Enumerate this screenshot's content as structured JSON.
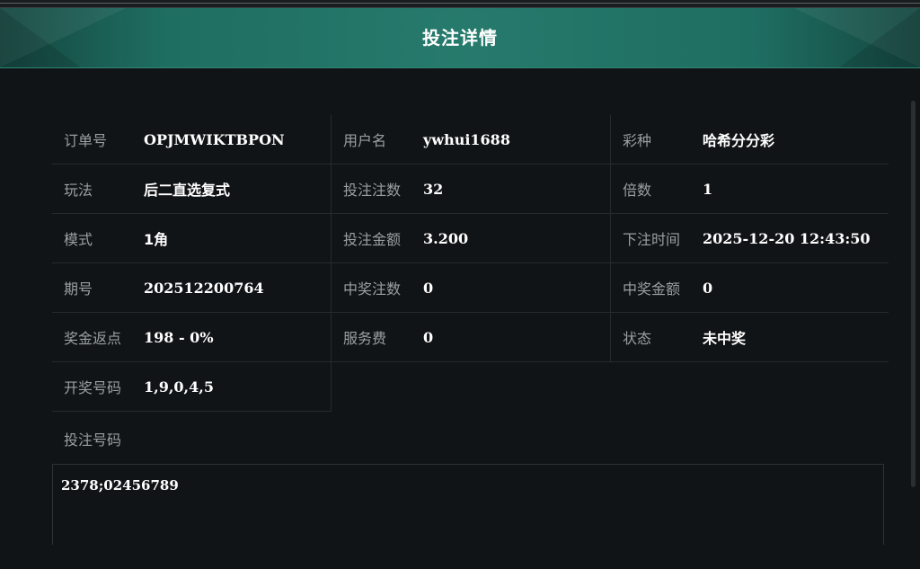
{
  "header": {
    "title": "投注详情"
  },
  "details": {
    "rows": [
      [
        {
          "label": "订单号",
          "value": "OPJMWIKTBPON"
        },
        {
          "label": "用户名",
          "value": "ywhui1688"
        },
        {
          "label": "彩种",
          "value": "哈希分分彩"
        }
      ],
      [
        {
          "label": "玩法",
          "value": "后二直选复式"
        },
        {
          "label": "投注注数",
          "value": "32"
        },
        {
          "label": "倍数",
          "value": "1"
        }
      ],
      [
        {
          "label": "模式",
          "value": "1角"
        },
        {
          "label": "投注金额",
          "value": "3.200"
        },
        {
          "label": "下注时间",
          "value": "2025-12-20 12:43:50"
        }
      ],
      [
        {
          "label": "期号",
          "value": "202512200764"
        },
        {
          "label": "中奖注数",
          "value": "0"
        },
        {
          "label": "中奖金额",
          "value": "0"
        }
      ],
      [
        {
          "label": "奖金返点",
          "value": "198 - 0%"
        },
        {
          "label": "服务费",
          "value": "0"
        },
        {
          "label": "状态",
          "value": "未中奖"
        }
      ],
      [
        {
          "label": "开奖号码",
          "value": "1,9,0,4,5"
        }
      ]
    ]
  },
  "bet_numbers": {
    "label": "投注号码",
    "value": "2378;02456789"
  }
}
